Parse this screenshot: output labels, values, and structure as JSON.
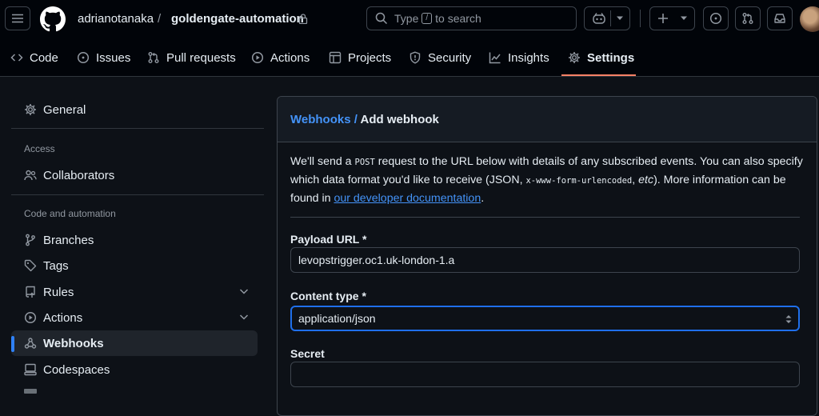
{
  "header": {
    "owner": "adrianotanaka",
    "separator": "/",
    "repo": "goldengate-automation",
    "search": {
      "prefix": "Type",
      "key": "/",
      "suffix": "to search"
    }
  },
  "tabs": [
    {
      "label": "Code",
      "icon": "code-icon"
    },
    {
      "label": "Issues",
      "icon": "issue-opened-icon"
    },
    {
      "label": "Pull requests",
      "icon": "git-pull-request-icon"
    },
    {
      "label": "Actions",
      "icon": "play-icon"
    },
    {
      "label": "Projects",
      "icon": "table-icon"
    },
    {
      "label": "Security",
      "icon": "shield-icon"
    },
    {
      "label": "Insights",
      "icon": "graph-icon"
    },
    {
      "label": "Settings",
      "icon": "gear-icon",
      "active": true
    }
  ],
  "sidebar": {
    "general": "General",
    "access_heading": "Access",
    "collaborators": "Collaborators",
    "code_heading": "Code and automation",
    "items": [
      {
        "label": "Branches",
        "icon": "git-branch-icon"
      },
      {
        "label": "Tags",
        "icon": "tag-icon"
      },
      {
        "label": "Rules",
        "icon": "repo-push-icon"
      },
      {
        "label": "Actions",
        "icon": "play-icon"
      },
      {
        "label": "Webhooks",
        "icon": "webhook-icon",
        "active": true
      },
      {
        "label": "Codespaces",
        "icon": "codespaces-icon"
      }
    ]
  },
  "panel": {
    "breadcrumb_link": "Webhooks",
    "breadcrumb_sep": "/",
    "title": "Add webhook",
    "desc": {
      "p1": "We'll send a ",
      "code1": "POST",
      "p2": " request to the URL below with details of any subscribed events. You can also specify which data format you'd like to receive (JSON, ",
      "code2": "x-www-form-urlencoded",
      "p3": ", ",
      "etc": "etc",
      "p4": "). More information can be found in ",
      "link": "our developer documentation",
      "p5": "."
    },
    "payload_label": "Payload URL *",
    "payload_value": "levopstrigger.oc1.uk-london-1.a",
    "content_type_label": "Content type *",
    "content_type_value": "application/json",
    "secret_label": "Secret",
    "secret_value": ""
  },
  "colors": {
    "accent": "#4493f8",
    "underline": "#f78166",
    "bg": "#0d1117"
  }
}
